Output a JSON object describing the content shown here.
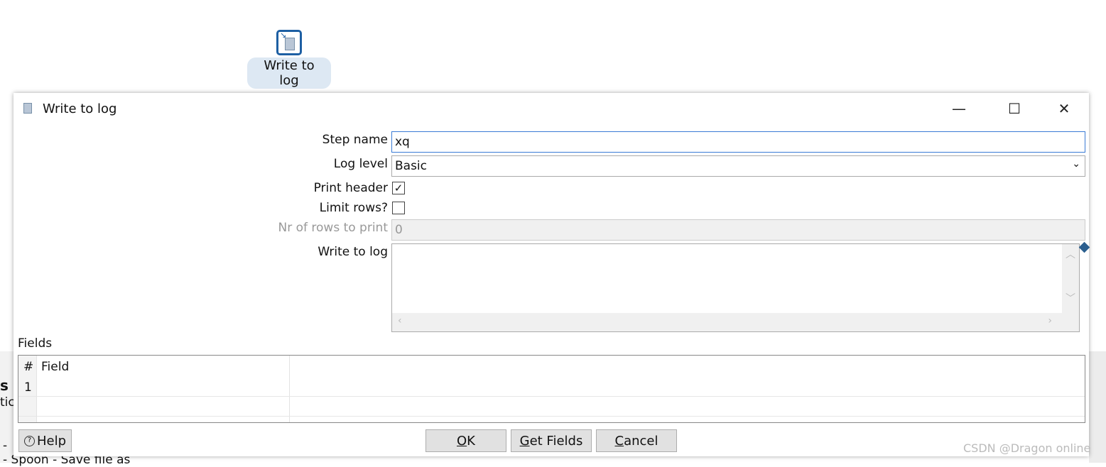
{
  "canvas": {
    "step_label": "Write to log"
  },
  "background": {
    "left_text_1": "s",
    "left_text_2": "tic",
    "bottom_text": "- Spoon - Save file as",
    "dash": "-"
  },
  "dialog": {
    "title": "Write to log",
    "window_controls": {
      "minimize": "—",
      "maximize": "☐",
      "close": "✕"
    },
    "form": {
      "step_name_label": "Step name",
      "step_name_value": "xq",
      "log_level_label": "Log level",
      "log_level_value": "Basic",
      "print_header_label": "Print header",
      "print_header_checked": true,
      "print_header_mark": "✓",
      "limit_rows_label": "Limit rows?",
      "limit_rows_checked": false,
      "nr_rows_label": "Nr of rows to print",
      "nr_rows_value": "0",
      "write_to_log_label": "Write to log",
      "write_to_log_value": ""
    },
    "fields": {
      "label": "Fields",
      "columns": [
        "#",
        "Field"
      ],
      "rows": [
        {
          "num": "1",
          "field": ""
        }
      ]
    },
    "buttons": {
      "help": "Help",
      "ok_u": "O",
      "ok_rest": "K",
      "get_u": "G",
      "get_rest": "et Fields",
      "cancel_u": "C",
      "cancel_rest": "ancel"
    }
  },
  "watermark": "CSDN @Dragon online"
}
